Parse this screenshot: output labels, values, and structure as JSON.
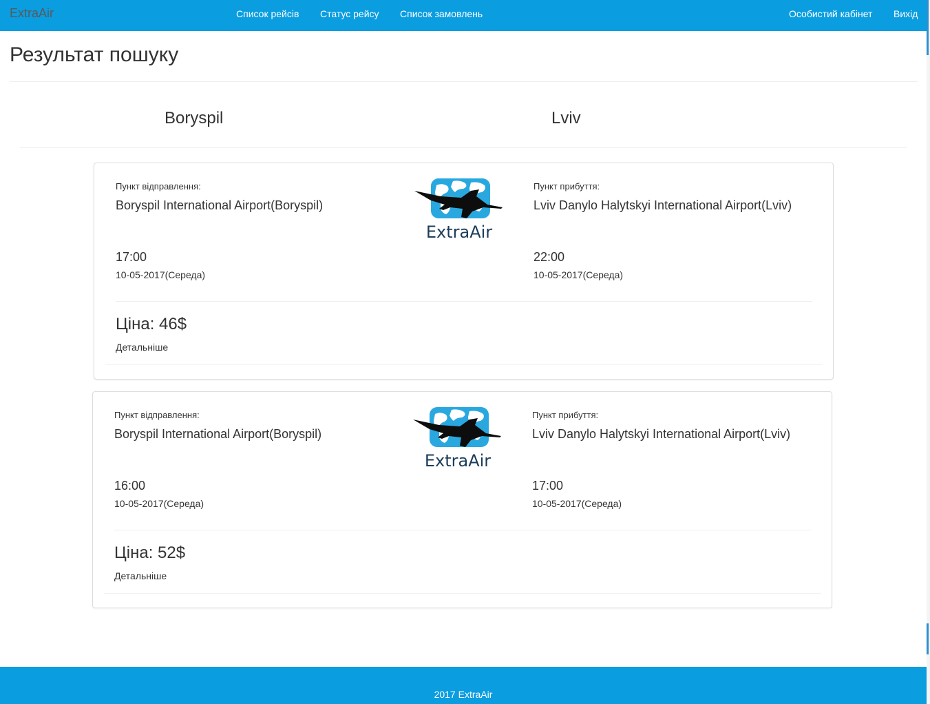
{
  "nav": {
    "brand": "ExtraAir",
    "links": [
      "Список рейсів",
      "Статус рейсу",
      "Список замовлень"
    ],
    "right_links": [
      "Особистий кабінет",
      "Вихід"
    ]
  },
  "page": {
    "title": "Результат пошуку",
    "from_city": "Boryspil",
    "to_city": "Lviv"
  },
  "labels": {
    "departure": "Пункт відправлення:",
    "arrival": "Пункт прибуття:",
    "details": "Детальніше"
  },
  "logo": {
    "text": "ExtraAir",
    "icon": "airplane-globe-icon"
  },
  "flights": [
    {
      "departure_airport": "Boryspil International Airport(Boryspil)",
      "arrival_airport": "Lviv Danylo Halytskyi International Airport(Lviv)",
      "departure_time": "17:00",
      "departure_date": "10-05-2017(Середа)",
      "arrival_time": "22:00",
      "arrival_date": "10-05-2017(Середа)",
      "price": "Ціна: 46$"
    },
    {
      "departure_airport": "Boryspil International Airport(Boryspil)",
      "arrival_airport": "Lviv Danylo Halytskyi International Airport(Lviv)",
      "departure_time": "16:00",
      "departure_date": "10-05-2017(Середа)",
      "arrival_time": "17:00",
      "arrival_date": "10-05-2017(Середа)",
      "price": "Ціна: 52$"
    }
  ],
  "footer": {
    "text": "2017 ExtraAir"
  },
  "colors": {
    "primary": "#0a9de0",
    "logo_blue": "#29a8e0",
    "logo_text": "#1c3d5a"
  }
}
